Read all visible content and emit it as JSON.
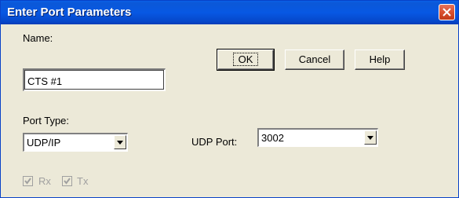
{
  "window": {
    "title": "Enter Port Parameters"
  },
  "name_field": {
    "label": "Name:",
    "value": "CTS #1"
  },
  "buttons": {
    "ok": "OK",
    "cancel": "Cancel",
    "help": "Help"
  },
  "port_type": {
    "label": "Port Type:",
    "value": "UDP/IP"
  },
  "udp_port": {
    "label": "UDP Port:",
    "value": "3002"
  },
  "checkboxes": {
    "rx": {
      "label": "Rx",
      "checked": true,
      "disabled": true
    },
    "tx": {
      "label": "Tx",
      "checked": true,
      "disabled": true
    }
  },
  "colors": {
    "titlebar": "#0758e3",
    "close": "#d9502f",
    "dialog_bg": "#ece9d8",
    "disabled_text": "#a0a0a0"
  },
  "icons": {
    "close": "close-icon",
    "dropdown": "chevron-down-icon",
    "check": "check-icon"
  }
}
